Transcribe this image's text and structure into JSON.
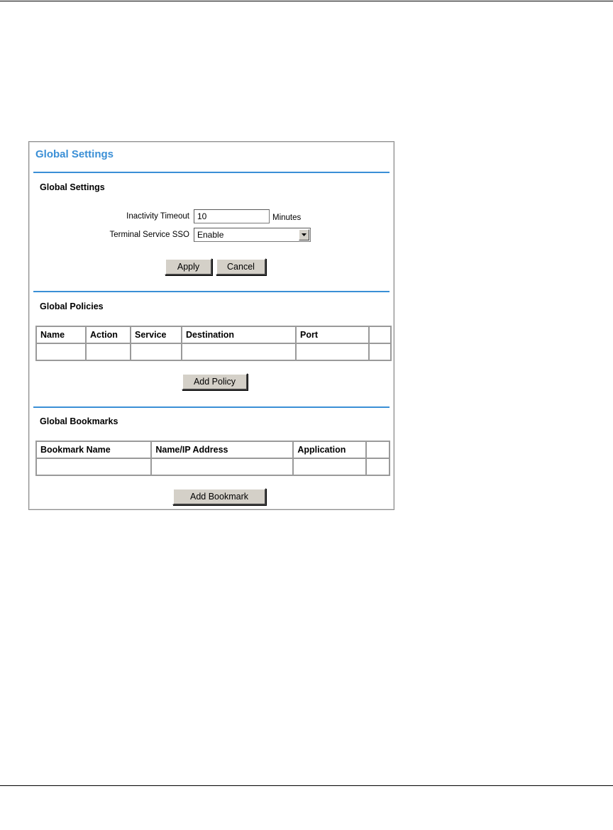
{
  "panel": {
    "title": "Global Settings",
    "accent_color": "#3a8fd6"
  },
  "settings": {
    "heading": "Global Settings",
    "inactivity_timeout_label": "Inactivity Timeout",
    "inactivity_timeout_value": "10",
    "inactivity_timeout_unit": "Minutes",
    "terminal_sso_label": "Terminal Service SSO",
    "terminal_sso_value": "Enable",
    "apply_label": "Apply",
    "cancel_label": "Cancel"
  },
  "policies": {
    "heading": "Global Policies",
    "columns": [
      "Name",
      "Action",
      "Service",
      "Destination",
      "Port",
      ""
    ],
    "rows": [
      [
        "",
        "",
        "",
        "",
        "",
        ""
      ]
    ],
    "add_label": "Add Policy"
  },
  "bookmarks": {
    "heading": "Global Bookmarks",
    "columns": [
      "Bookmark Name",
      "Name/IP Address",
      "Application",
      ""
    ],
    "rows": [
      [
        "",
        "",
        "",
        ""
      ]
    ],
    "add_label": "Add Bookmark"
  },
  "icons": {
    "dropdown": "chevron-down-icon"
  }
}
